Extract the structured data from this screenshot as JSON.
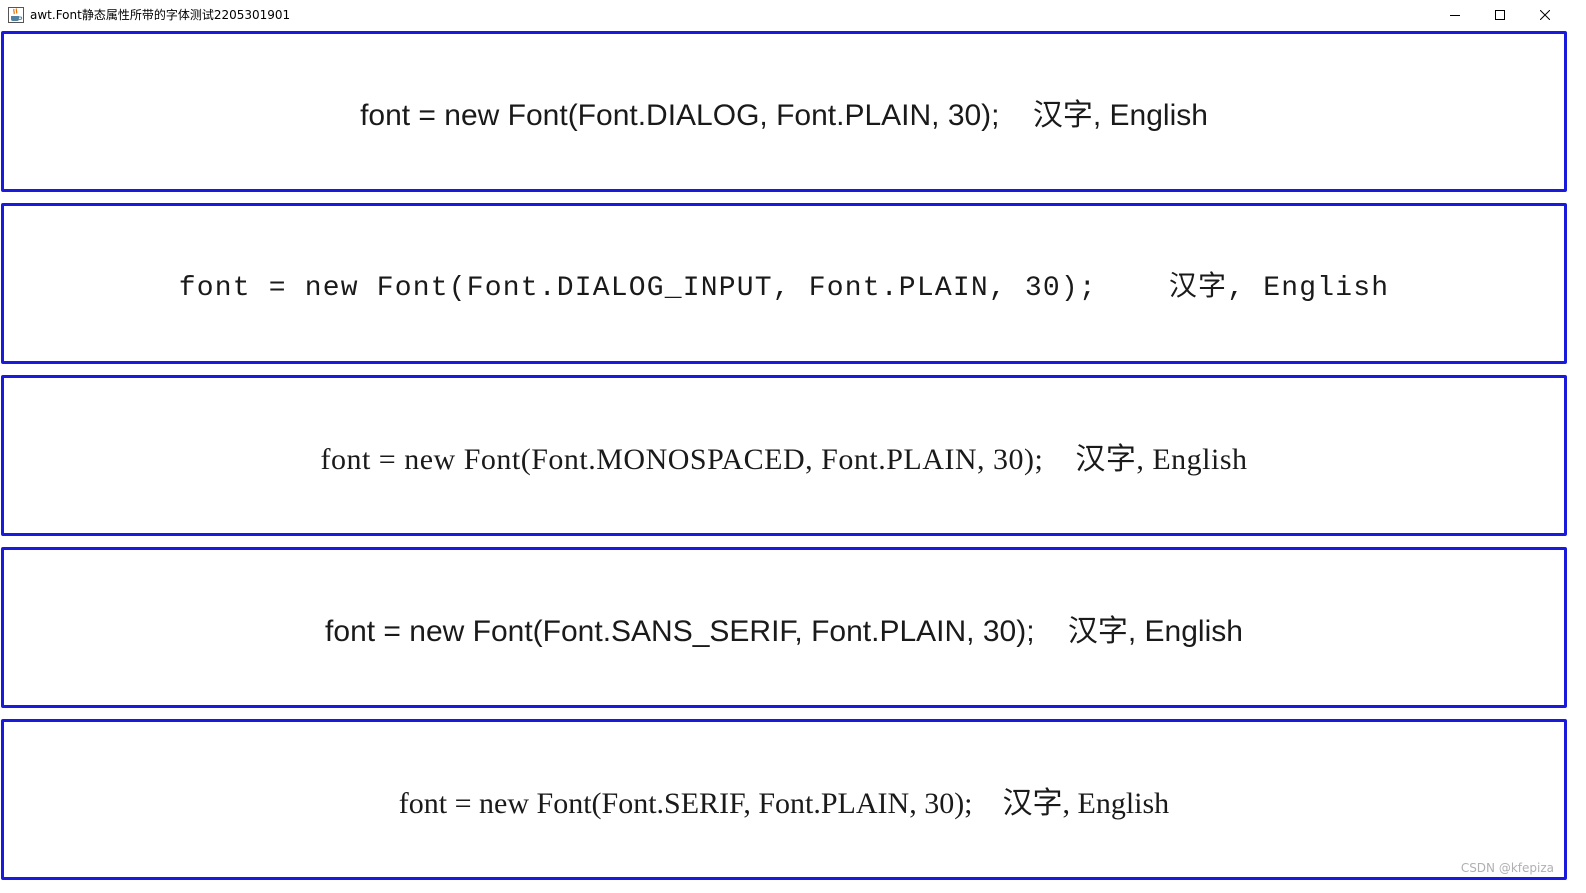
{
  "window": {
    "title": "awt.Font静态属性所带的字体测试2205301901",
    "icon": "java-cup-icon",
    "controls": {
      "minimize_icon": "minimize-icon",
      "maximize_icon": "maximize-icon",
      "close_icon": "close-icon"
    }
  },
  "panels": [
    {
      "text": "font = new Font(Font.DIALOG, Font.PLAIN, 30);    汉字, English"
    },
    {
      "text": "font = new Font(Font.DIALOG_INPUT, Font.PLAIN, 30);    汉字, English"
    },
    {
      "text": "font = new Font(Font.MONOSPACED, Font.PLAIN, 30);    汉字, English"
    },
    {
      "text": "font = new Font(Font.SANS_SERIF, Font.PLAIN, 30);    汉字, English"
    },
    {
      "text": "font = new Font(Font.SERIF, Font.PLAIN, 30);    汉字, English"
    }
  ],
  "watermark": "CSDN @kfepiza",
  "colors": {
    "panel_border": "#1a1add",
    "background": "#ffffff",
    "text": "#1a1a1a"
  }
}
